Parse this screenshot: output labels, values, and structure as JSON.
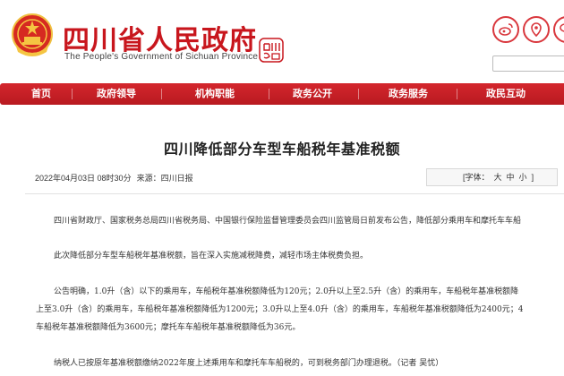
{
  "header": {
    "site_name": "四川省人民政府",
    "site_subtitle": "The People's Government of Sichuan Province",
    "seal_text": "四川\n印象",
    "icons": [
      "weibo-icon",
      "pin-icon",
      "wechat-icon"
    ],
    "colors": {
      "brand_red": "#c8161d",
      "nav_red": "#c41e24"
    }
  },
  "nav": {
    "items": [
      {
        "label": "首页"
      },
      {
        "label": "政府领导"
      },
      {
        "label": "机构职能"
      },
      {
        "label": "政务公开"
      },
      {
        "label": "政务服务"
      },
      {
        "label": "政民互动"
      }
    ]
  },
  "article": {
    "title": "四川降低部分车型车船税年基准税额",
    "date": "2022年04月03日 08时30分",
    "source": "来源：四川日报",
    "font_size_label": "[字体：",
    "font_size_options": [
      "大",
      "中",
      "小"
    ],
    "font_size_close": "]",
    "paragraphs": [
      "四川省财政厅、国家税务总局四川省税务局、中国银行保险监督管理委员会四川监管局日前发布公告，降低部分乘用车和摩托车车船",
      "此次降低部分车型车船税年基准税额，旨在深入实施减税降费，减轻市场主体税费负担。",
      "公告明确，1.0升（含）以下的乘用车，车船税年基准税额降低为120元；2.0升以上至2.5升（含）的乘用车，车船税年基准税额降",
      "上至3.0升（含）的乘用车，车船税年基准税额降低为1200元；3.0升以上至4.0升（含）的乘用车，车船税年基准税额降低为2400元；4",
      "车船税年基准税额降低为3600元；摩托车车船税年基准税额降低为36元。",
      "纳税人已按原年基准税额缴纳2022年度上述乘用车和摩托车车船税的，可到税务部门办理退税。（记者 吴忧）"
    ]
  }
}
